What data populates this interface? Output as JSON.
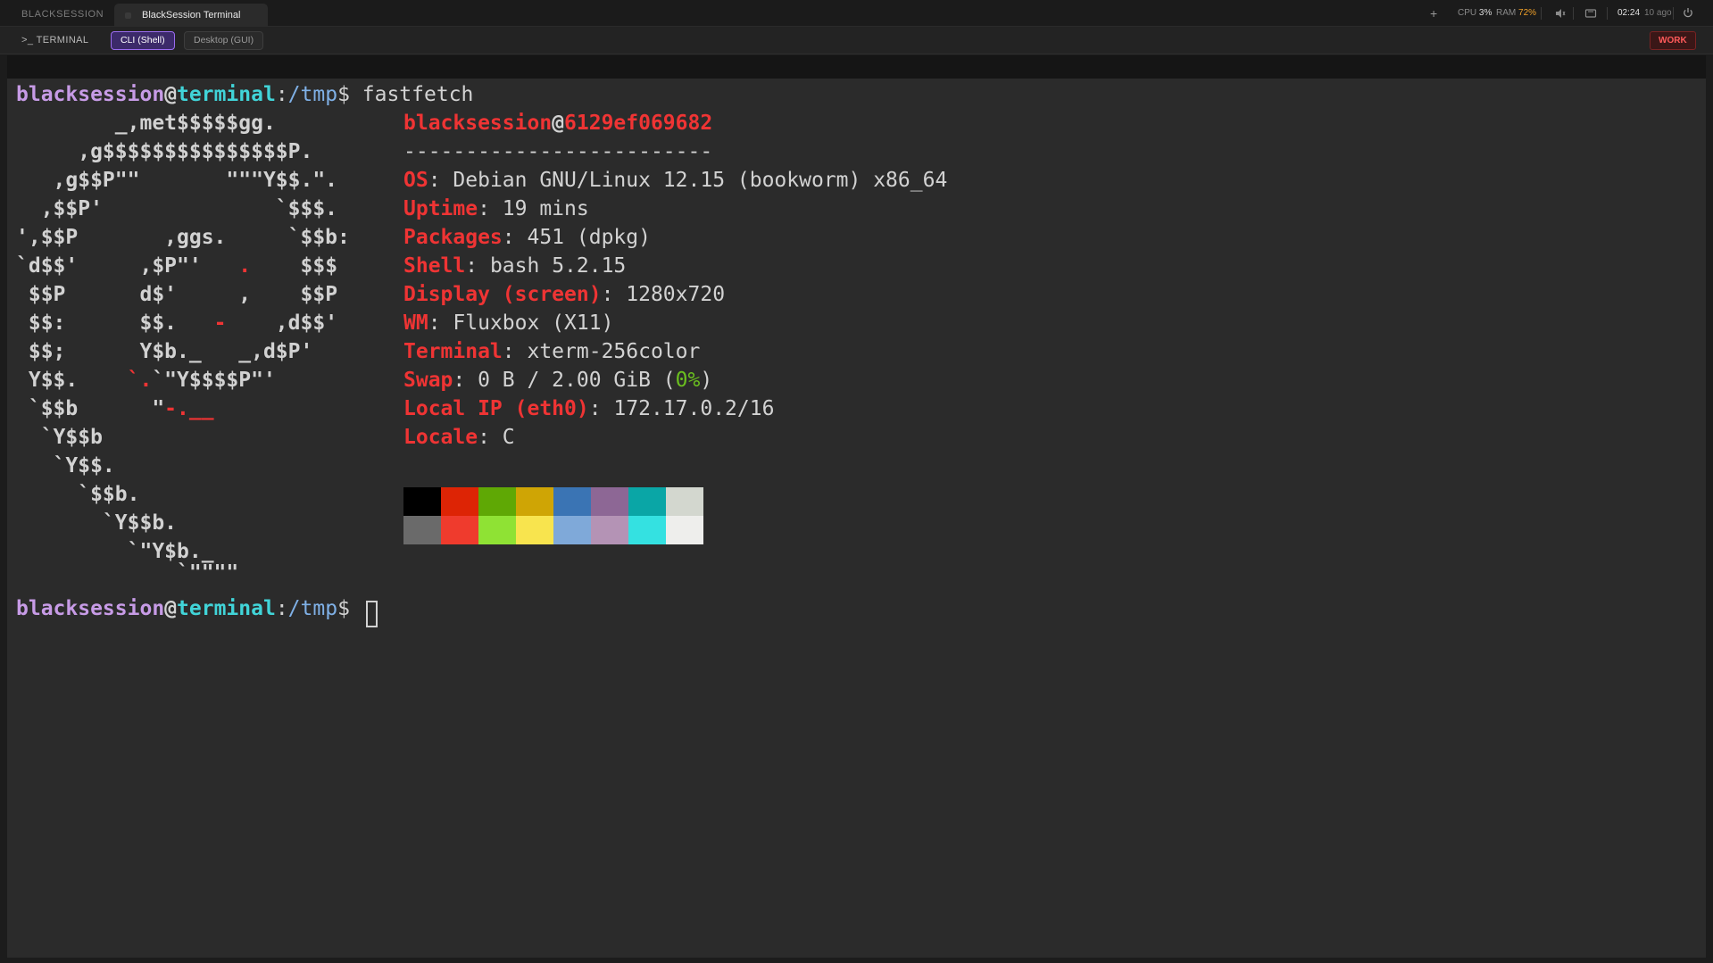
{
  "topbar": {
    "app_name": "BLACKSESSION",
    "active_tab": "BlackSession Terminal",
    "new_tab": "+",
    "cpu_label": "CPU",
    "cpu_value": "3%",
    "ram_label": "RAM",
    "ram_value": "72%",
    "clock": "02:24",
    "ago": "10 ago"
  },
  "modebar": {
    "terminal_label": ">_ TERMINAL",
    "cli_button": "CLI (Shell)",
    "gui_button": "Desktop (GUI)",
    "work_badge": "WORK"
  },
  "terminal": {
    "prompt": {
      "user": "blacksession",
      "at": "@",
      "host": "terminal",
      "colon": ":",
      "path": "/tmp",
      "dollar": "$ "
    },
    "command": "fastfetch",
    "logo": [
      "        _,met$$$$$gg.",
      "     ,g$$$$$$$$$$$$$$$P.",
      "   ,g$$P\"\"       \"\"\"Y$$.\".",
      "  ,$$P'              `$$$.",
      "',$$P       ,ggs.     `$$b:",
      "`d$$'     ,$P\"'   .    $$$",
      " $$P      d$'     ,    $$P",
      " $$:      $$.   -    ,d$$'",
      " $$;      Y$b._   _,d$P'",
      " Y$$.    `.`\"Y$$$$P\"'",
      " `$$b      \"-.__",
      "  `Y$$b",
      "   `Y$$.",
      "     `$$b.",
      "       `Y$$b.",
      "         `\"Y$b._",
      "             `\"\"\"\""
    ],
    "info": {
      "user": "blacksession",
      "at": "@",
      "host": "6129ef069682",
      "separator": "-------------------------",
      "rows": [
        {
          "key": "OS",
          "value": "Debian GNU/Linux 12.15 (bookworm) x86_64"
        },
        {
          "key": "Uptime",
          "value": "19 mins"
        },
        {
          "key": "Packages",
          "value": "451 (dpkg)"
        },
        {
          "key": "Shell",
          "value": "bash 5.2.15"
        },
        {
          "key": "Display (screen)",
          "value": "1280x720"
        },
        {
          "key": "WM",
          "value": "Fluxbox (X11)"
        },
        {
          "key": "Terminal",
          "value": "xterm-256color"
        },
        {
          "key": "Swap",
          "value_prefix": "0 B / 2.00 GiB (",
          "value_pct": "0%",
          "value_suffix": ")"
        },
        {
          "key": "Local IP (eth0)",
          "value": "172.17.0.2/16"
        },
        {
          "key": "Locale",
          "value": "C"
        }
      ],
      "sep_char": ": "
    },
    "palette": {
      "normal": [
        "#000000",
        "#dd2405",
        "#5fa805",
        "#cfa505",
        "#3a74b4",
        "#8d6795",
        "#0aa6a6",
        "#d3d7cf"
      ],
      "bright": [
        "#6a6a6a",
        "#ef3b2d",
        "#8fe234",
        "#f8e44e",
        "#7fa9d9",
        "#b493b5",
        "#34e1e1",
        "#eeeeec"
      ]
    }
  },
  "colors": {
    "accent": "#9b6cf0",
    "prompt_user": "#c79be6",
    "prompt_host": "#41d4d8",
    "prompt_path": "#7fb0e6",
    "debian_red": "#ef3434",
    "ram_warn": "#f0a028",
    "work_red": "#ff5a5a"
  },
  "icons": [
    "plus-icon",
    "volume-icon",
    "cast-icon",
    "power-icon"
  ]
}
